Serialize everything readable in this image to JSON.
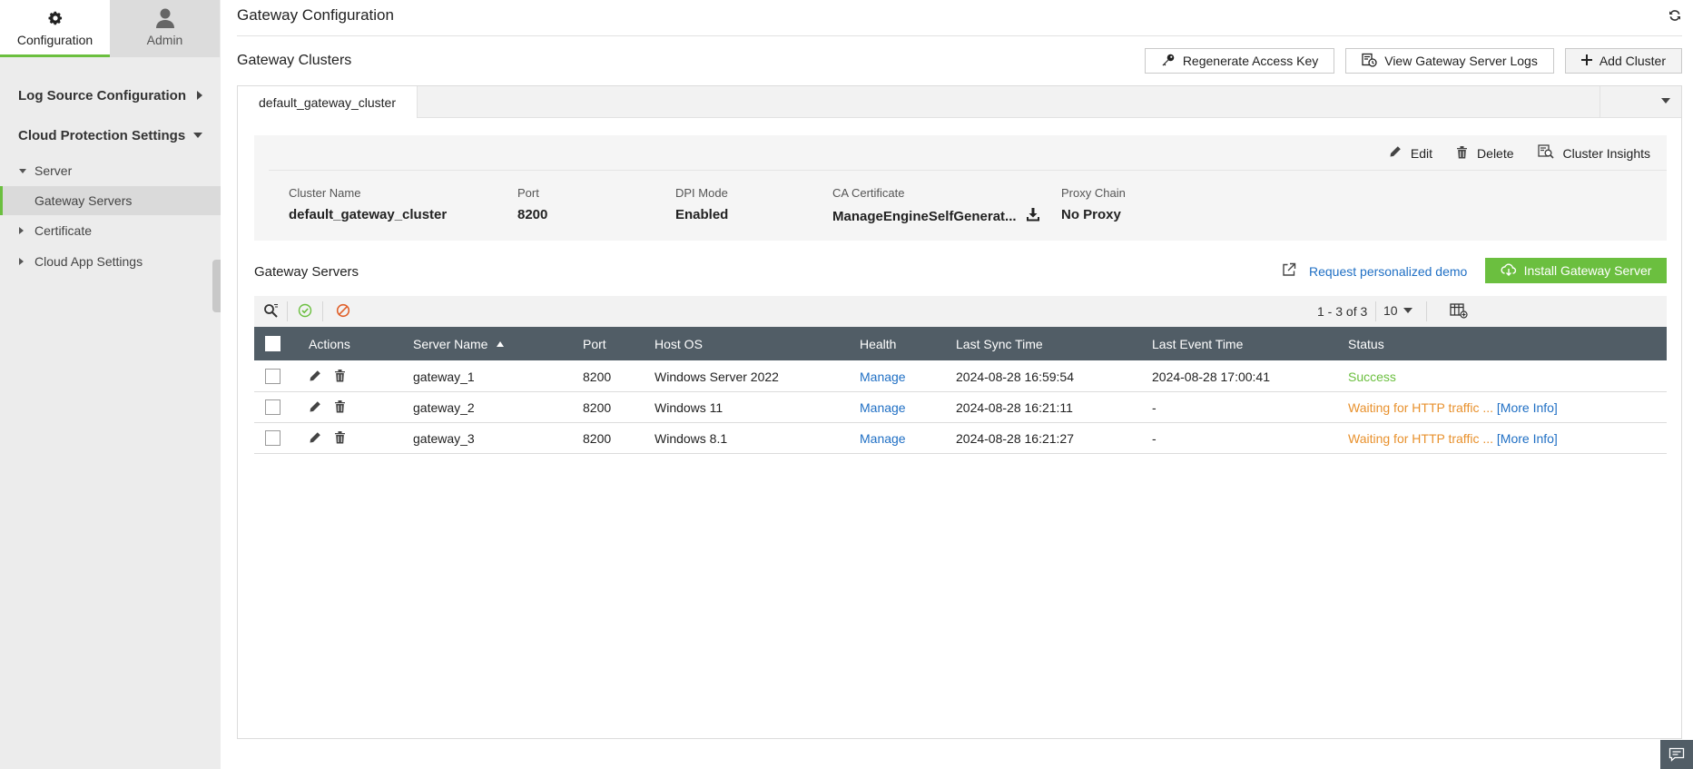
{
  "sidebar": {
    "tabs": [
      {
        "label": "Configuration",
        "icon": "gear-icon"
      },
      {
        "label": "Admin",
        "icon": "user-icon"
      }
    ],
    "sections": [
      {
        "label": "Log Source Configuration"
      },
      {
        "label": "Cloud Protection Settings"
      }
    ],
    "server_group": "Server",
    "gateway_servers": "Gateway Servers",
    "certificate": "Certificate",
    "cloud_app_settings": "Cloud App Settings"
  },
  "header": {
    "title": "Gateway Configuration",
    "refresh_icon": "refresh-icon"
  },
  "clusters": {
    "title": "Gateway Clusters",
    "buttons": {
      "regenerate": "Regenerate Access Key",
      "view_logs": "View Gateway Server Logs",
      "add_cluster": "Add Cluster"
    },
    "active_tab": "default_gateway_cluster"
  },
  "cluster_info": {
    "actions": {
      "edit": "Edit",
      "delete": "Delete",
      "insights": "Cluster Insights"
    },
    "fields": [
      {
        "key": "Cluster Name",
        "value": "default_gateway_cluster"
      },
      {
        "key": "Port",
        "value": "8200"
      },
      {
        "key": "DPI Mode",
        "value": "Enabled"
      },
      {
        "key": "CA Certificate",
        "value": "ManageEngineSelfGenerat..."
      },
      {
        "key": "Proxy Chain",
        "value": "No Proxy"
      }
    ]
  },
  "servers": {
    "title": "Gateway Servers",
    "demo_link": "Request personalized demo",
    "install_button": "Install Gateway Server",
    "pager": "1 - 3 of 3",
    "per_page": "10",
    "columns": [
      "Actions",
      "Server Name",
      "Port",
      "Host OS",
      "Health",
      "Last Sync Time",
      "Last Event Time",
      "Status"
    ],
    "rows": [
      {
        "name": "gateway_1",
        "port": "8200",
        "os": "Windows Server 2022",
        "health": "Manage",
        "sync": "2024-08-28 16:59:54",
        "event": "2024-08-28 17:00:41",
        "status": "Success",
        "more": ""
      },
      {
        "name": "gateway_2",
        "port": "8200",
        "os": "Windows 11",
        "health": "Manage",
        "sync": "2024-08-28 16:21:11",
        "event": "-",
        "status": "Waiting for HTTP traffic ...",
        "more": "[More Info]"
      },
      {
        "name": "gateway_3",
        "port": "8200",
        "os": "Windows 8.1",
        "health": "Manage",
        "sync": "2024-08-28 16:21:27",
        "event": "-",
        "status": "Waiting for HTTP traffic ...",
        "more": "[More Info]"
      }
    ]
  },
  "colors": {
    "accent_green": "#6bbf3f",
    "link_blue": "#1f6fc4",
    "warning_orange": "#e8912d",
    "table_header": "#515d66"
  }
}
